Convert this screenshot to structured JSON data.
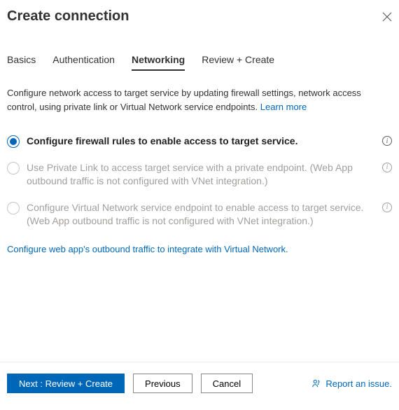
{
  "header": {
    "title": "Create connection"
  },
  "tabs": [
    {
      "label": "Basics",
      "active": false
    },
    {
      "label": "Authentication",
      "active": false
    },
    {
      "label": "Networking",
      "active": true
    },
    {
      "label": "Review + Create",
      "active": false
    }
  ],
  "description": {
    "text": "Configure network access to target service by updating firewall settings, network access control, using private link or Virtual Network service endpoints. ",
    "learn_more": "Learn more"
  },
  "options": [
    {
      "label": "Configure firewall rules to enable access to target service.",
      "selected": true,
      "disabled": false,
      "info": true
    },
    {
      "label": "Use Private Link to access target service with a private endpoint. (Web App outbound traffic is not configured with VNet integration.)",
      "selected": false,
      "disabled": true,
      "info": true
    },
    {
      "label": "Configure Virtual Network service endpoint to enable access to target service. (Web App outbound traffic is not configured with VNet integration.)",
      "selected": false,
      "disabled": true,
      "info": true
    }
  ],
  "configure_link": "Configure web app's outbound traffic to integrate with Virtual Network.",
  "footer": {
    "primary": "Next : Review + Create",
    "previous": "Previous",
    "cancel": "Cancel",
    "report": "Report an issue."
  }
}
